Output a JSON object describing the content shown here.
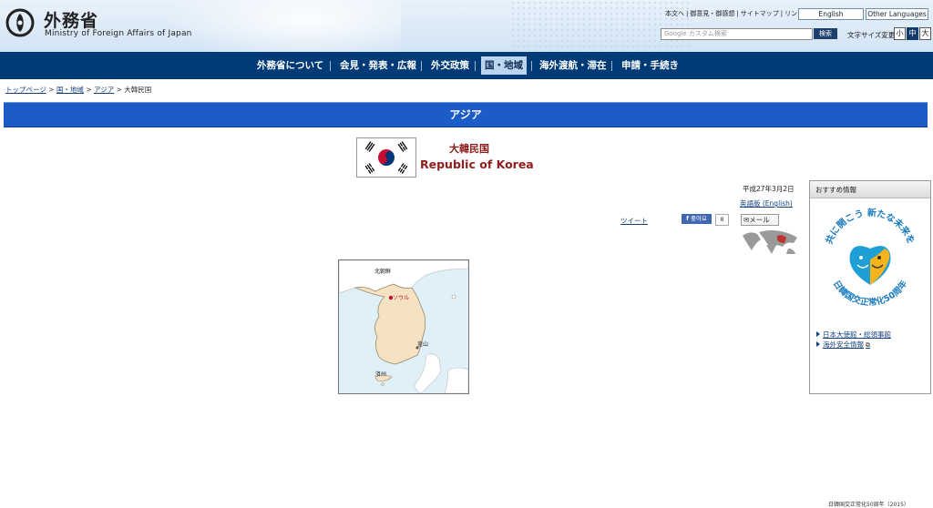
{
  "header": {
    "logo_jp": "外務省",
    "logo_en": "Ministry of Foreign Affairs of Japan",
    "util_links": [
      "本文へ",
      "御意見・御感想",
      "サイトマップ",
      "リンク集"
    ],
    "lang_buttons": [
      "English",
      "Other Languages"
    ],
    "search_placeholder": "Google カスタム検索",
    "search_button": "検索",
    "font_size_label": "文字サイズ変更",
    "font_sizes": [
      "小",
      "中",
      "大"
    ]
  },
  "nav": {
    "items": [
      "外務省について",
      "会見・発表・広報",
      "外交政策",
      "国・地域",
      "海外渡航・滞在",
      "申請・手続き"
    ]
  },
  "breadcrumb": {
    "links": [
      "トップページ",
      "国・地域",
      "アジア"
    ],
    "current": "大韓民国",
    "separator": ">"
  },
  "region_bar": "アジア",
  "country": {
    "name_jp": "大韓民国",
    "name_en": "Republic of Korea"
  },
  "meta": {
    "date": "平成27年3月2日",
    "english_link": "英語版 (English)",
    "tweet": "ツイート",
    "fb_like": "좋아요",
    "fb_count": "8",
    "mail": "メール"
  },
  "map": {
    "north_label": "北朝鮮",
    "seoul_label": "ソウル",
    "busan_label": "釜山",
    "jeju_label": "済州"
  },
  "recommend": {
    "heading": "おすすめ情報",
    "banner_line1": "共に開こう 新たな未来を",
    "banner_line2": "日韓国交正常化50周年",
    "caption": "日韓国交正常化50周年（2015）",
    "links": [
      "日本大使館・総領事館",
      "海外安全情報"
    ]
  },
  "colors": {
    "nav_bg": "#003b77",
    "region_bar": "#1c5cc6",
    "country_name": "#8e1d1d",
    "link": "#14417e"
  }
}
